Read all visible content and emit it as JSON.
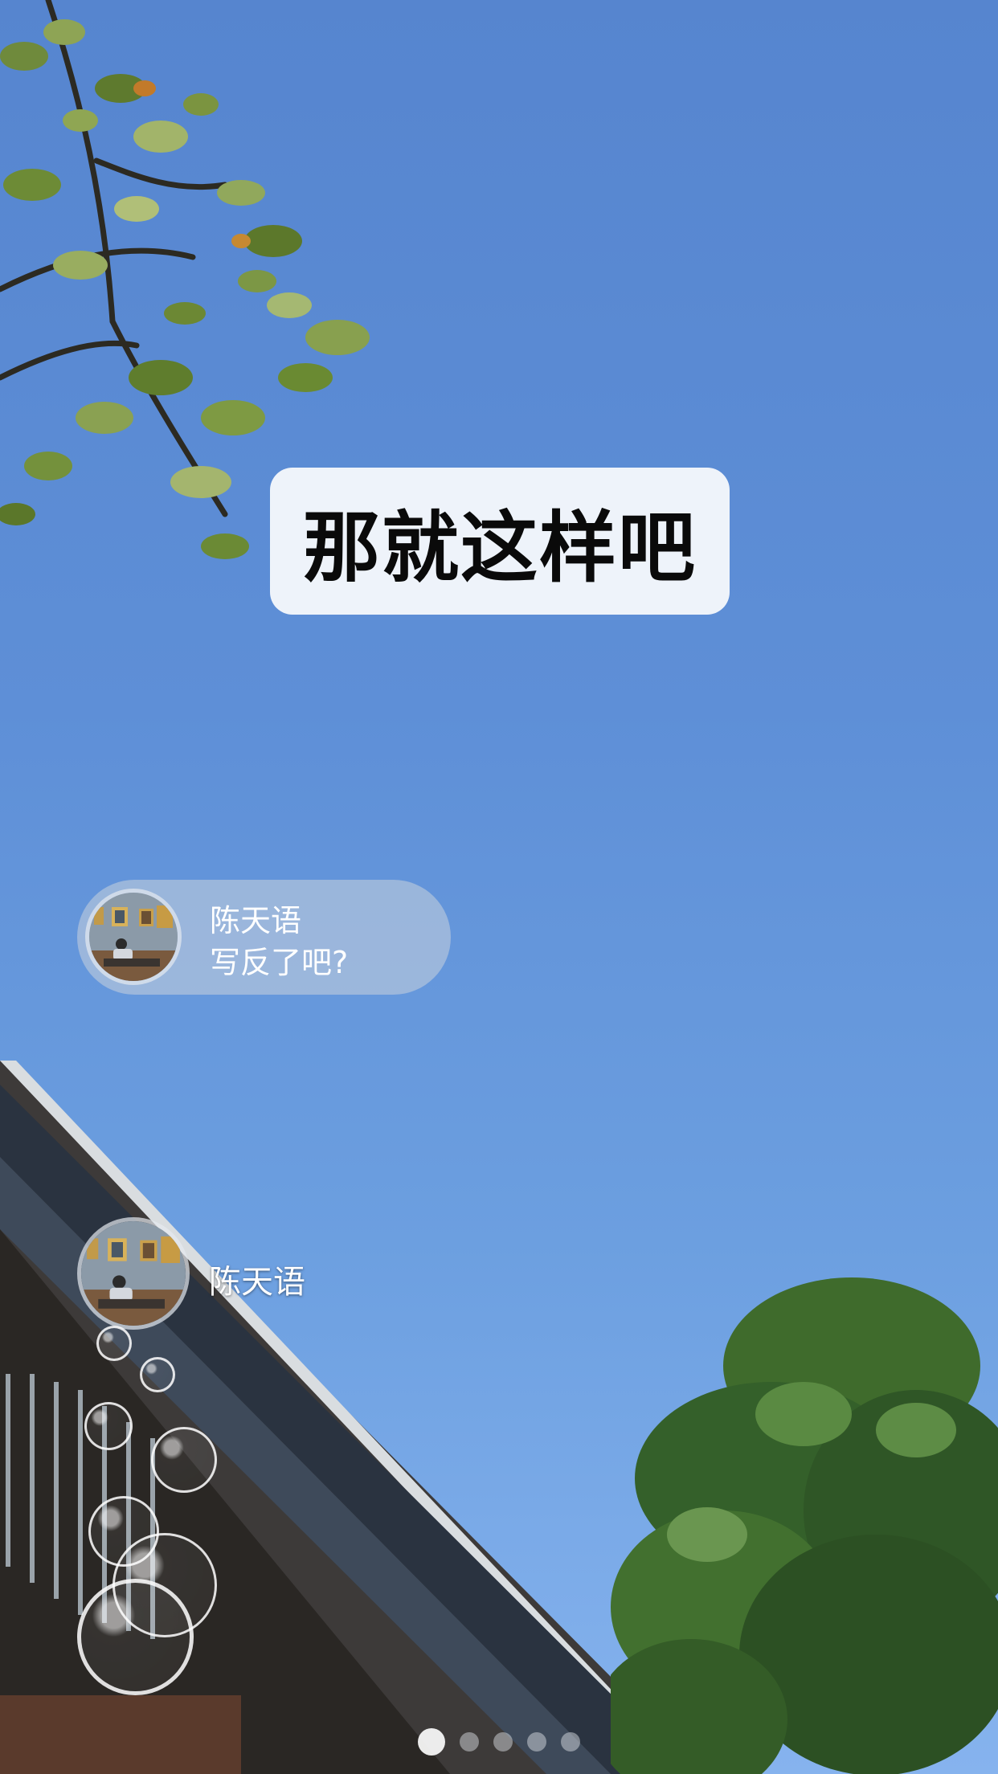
{
  "caption": {
    "text": "那就这样吧"
  },
  "comment": {
    "user_name": "陈天语",
    "message": "写反了吧?"
  },
  "live_user": {
    "user_name": "陈天语"
  },
  "pager": {
    "total_pages": 5,
    "current_page": 1
  },
  "colors": {
    "sky": "#5e8fd7",
    "caption_bg": "#eef3fa",
    "caption_text": "#0a0a0a"
  }
}
